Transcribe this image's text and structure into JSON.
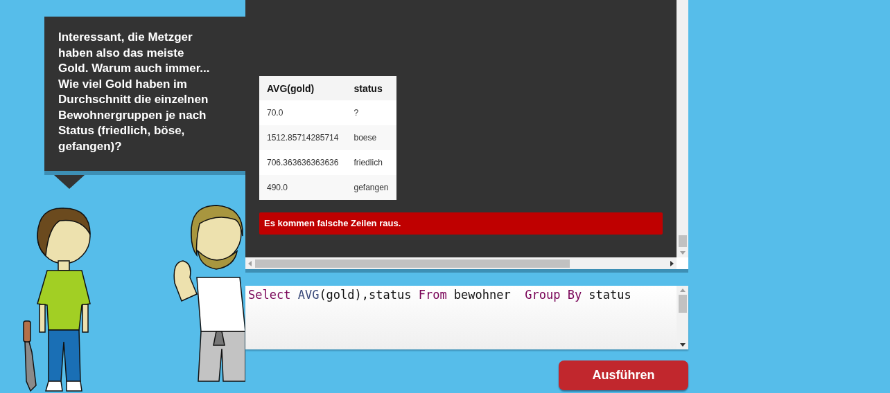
{
  "speech_bubble": {
    "text": "Interessant, die Metzger haben also das meiste Gold. Warum auch immer... Wie viel Gold haben im Durchschnitt die einzelnen Bewohnergruppen je nach Status (friedlich, böse, gefangen)?"
  },
  "result_table": {
    "columns": [
      "AVG(gold)",
      "status"
    ],
    "rows": [
      [
        "70.0",
        "?"
      ],
      [
        "1512.85714285714",
        "boese"
      ],
      [
        "706.363636363636",
        "friedlich"
      ],
      [
        "490.0",
        "gefangen"
      ]
    ]
  },
  "error_message": "Es kommen falsche Zeilen raus.",
  "query_editor": {
    "tokens": [
      {
        "kind": "keyword",
        "text": "Select"
      },
      {
        "kind": "function",
        "text": " AVG"
      },
      {
        "kind": "plain",
        "text": "(gold),status "
      },
      {
        "kind": "keyword",
        "text": "From"
      },
      {
        "kind": "plain",
        "text": " bewohner  "
      },
      {
        "kind": "keyword",
        "text": "Group"
      },
      {
        "kind": "keyword",
        "text": " By"
      },
      {
        "kind": "plain",
        "text": " status"
      }
    ]
  },
  "run_button": {
    "label": "Ausführen"
  }
}
